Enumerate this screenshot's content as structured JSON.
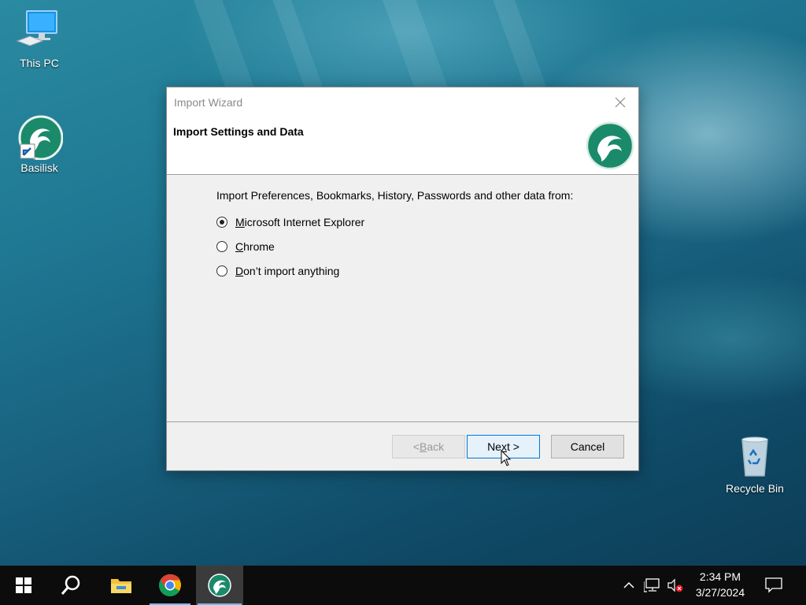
{
  "desktop": {
    "icons": [
      {
        "label": "This PC"
      },
      {
        "label": "Basilisk"
      },
      {
        "label": "Recycle Bin"
      }
    ]
  },
  "dialog": {
    "title": "Import Wizard",
    "header_title": "Import Settings and Data",
    "intro": "Import Preferences, Bookmarks, History, Passwords and other data from:",
    "options": [
      {
        "mnemonic": "M",
        "rest": "icrosoft Internet Explorer",
        "checked": true
      },
      {
        "mnemonic": "C",
        "rest": "hrome",
        "checked": false
      },
      {
        "mnemonic": "D",
        "rest": "on’t import anything",
        "checked": false
      }
    ],
    "buttons": {
      "back": {
        "pre": "< ",
        "mnemonic": "B",
        "post": "ack",
        "enabled": false
      },
      "next": {
        "pre": "Ne",
        "mnemonic": "x",
        "post": "t >"
      },
      "cancel": "Cancel"
    }
  },
  "taskbar": {
    "pinned": [
      "start-icon",
      "search-icon",
      "file-explorer-icon",
      "chrome-icon",
      "basilisk-icon"
    ],
    "active": "basilisk-icon",
    "clock": {
      "time": "2:34 PM",
      "date": "3/27/2024"
    }
  },
  "colors": {
    "accent": "#0078d7",
    "basilisk_green": "#1a8a6a",
    "taskbar": "#0c0c0c"
  }
}
